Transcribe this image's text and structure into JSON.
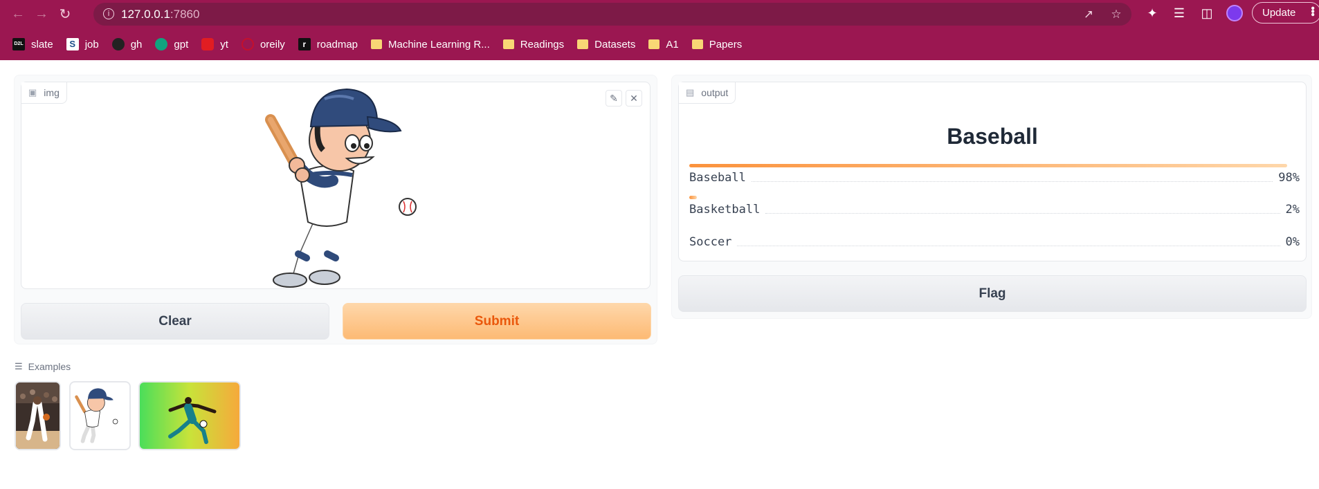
{
  "browser": {
    "url_host": "127.0.0.1",
    "url_port": ":7860",
    "update_label": "Update",
    "bookmarks": [
      {
        "label": "slate",
        "icon": "d2l-icon",
        "badge": "D2L"
      },
      {
        "label": "job",
        "icon": "seek-icon",
        "badge": "S"
      },
      {
        "label": "gh",
        "icon": "github-icon"
      },
      {
        "label": "gpt",
        "icon": "openai-icon"
      },
      {
        "label": "yt",
        "icon": "youtube-icon"
      },
      {
        "label": "oreily",
        "icon": "oreilly-icon"
      },
      {
        "label": "roadmap",
        "icon": "roadmap-icon",
        "badge": "r"
      },
      {
        "label": "Machine Learning R...",
        "icon": "folder-icon"
      },
      {
        "label": "Readings",
        "icon": "folder-icon"
      },
      {
        "label": "Datasets",
        "icon": "folder-icon"
      },
      {
        "label": "A1",
        "icon": "folder-icon"
      },
      {
        "label": "Papers",
        "icon": "folder-icon"
      }
    ]
  },
  "input_panel": {
    "label": "img",
    "clear_label": "Clear",
    "submit_label": "Submit"
  },
  "output_panel": {
    "label": "output",
    "prediction": "Baseball",
    "confidences": [
      {
        "label": "Baseball",
        "value": "98%",
        "fraction": 0.98
      },
      {
        "label": "Basketball",
        "value": "2%",
        "fraction": 0.02
      },
      {
        "label": "Soccer",
        "value": "0%",
        "fraction": 0.0
      }
    ],
    "flag_label": "Flag"
  },
  "examples": {
    "label": "Examples"
  },
  "colors": {
    "chrome": "#9b1751",
    "accent": "#fb923c"
  }
}
